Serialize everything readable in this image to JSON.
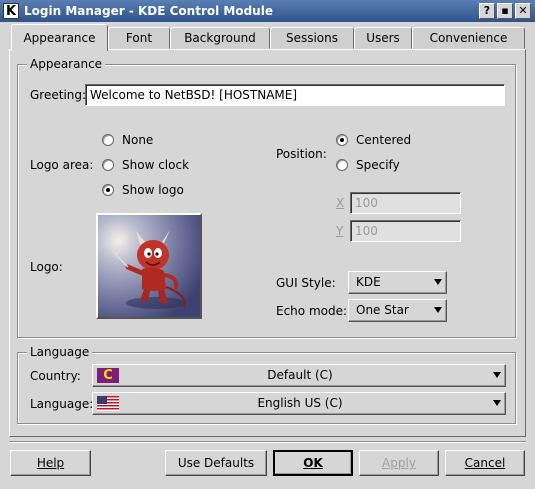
{
  "window": {
    "title": "Login Manager - KDE Control Module",
    "app_icon": "K",
    "help_glyph": "?",
    "minimize_glyph": "▪",
    "close_glyph": "✕"
  },
  "tabs": [
    "Appearance",
    "Font",
    "Background",
    "Sessions",
    "Users",
    "Convenience"
  ],
  "appearance": {
    "group_title": "Appearance",
    "greeting_label": "Greeting:",
    "greeting_value": "Welcome to NetBSD! [HOSTNAME]",
    "logo_area_label": "Logo area:",
    "logo_area_options": [
      "None",
      "Show clock",
      "Show logo"
    ],
    "logo_area_selected": "Show logo",
    "position_label": "Position:",
    "position_options": [
      "Centered",
      "Specify"
    ],
    "position_selected": "Centered",
    "x_label": "X",
    "x_value": "100",
    "y_label": "Y",
    "y_value": "100",
    "logo_label": "Logo:",
    "gui_style_label": "GUI Style:",
    "gui_style_value": "KDE",
    "echo_mode_label": "Echo mode:",
    "echo_mode_value": "One Star"
  },
  "language": {
    "group_title": "Language",
    "country_label": "Country:",
    "country_value": "Default (C)",
    "country_flag_glyph": "C",
    "language_label": "Language:",
    "language_value": "English US (C)"
  },
  "buttons": {
    "help": "Help",
    "use_defaults": "Use Defaults",
    "ok": "OK",
    "apply": "Apply",
    "cancel": "Cancel"
  },
  "colors": {
    "titlebar": "#2e548c",
    "country_flag": "#7a1f7a"
  }
}
